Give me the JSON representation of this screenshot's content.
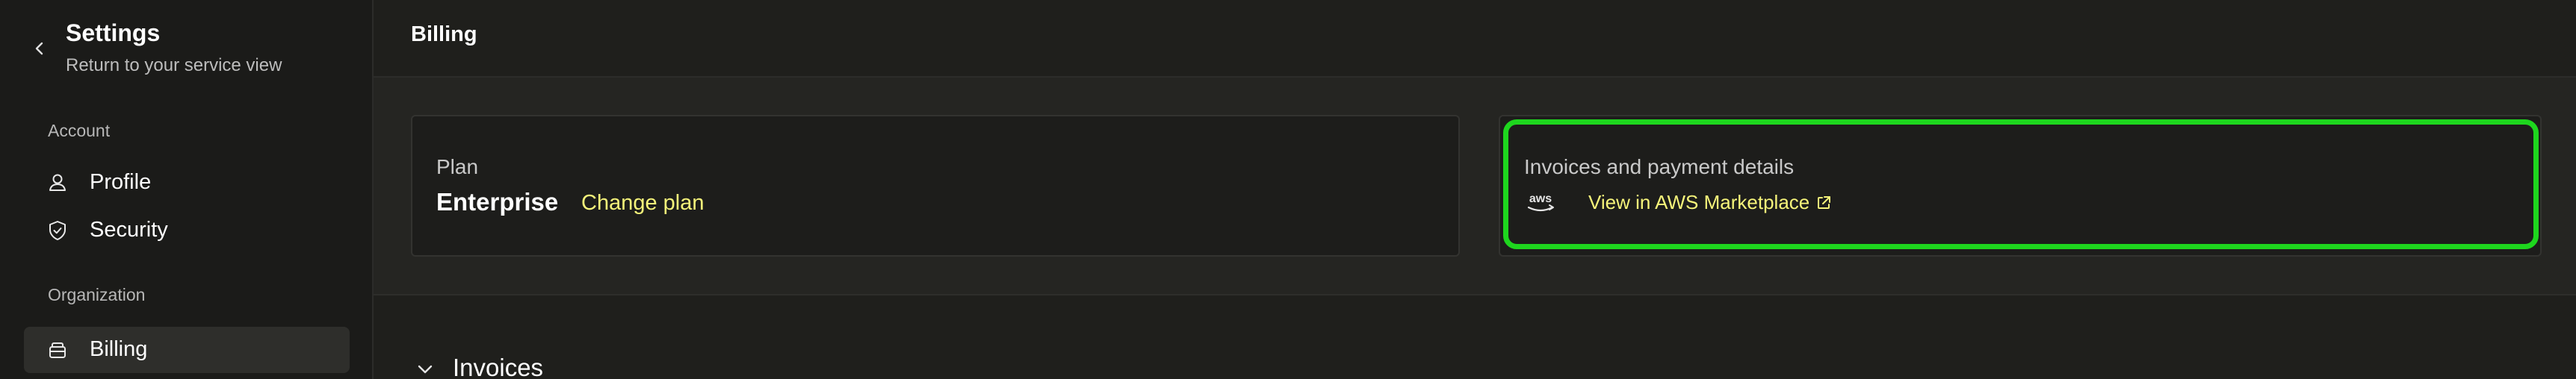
{
  "sidebar": {
    "title": "Settings",
    "subtitle": "Return to your service view",
    "sections": [
      {
        "label": "Account",
        "items": [
          {
            "label": "Profile",
            "icon": "user-icon",
            "active": false
          },
          {
            "label": "Security",
            "icon": "shield-icon",
            "active": false
          }
        ]
      },
      {
        "label": "Organization",
        "items": [
          {
            "label": "Billing",
            "icon": "wallet-icon",
            "active": true
          }
        ]
      }
    ]
  },
  "header": {
    "title": "Billing"
  },
  "plan_card": {
    "label": "Plan",
    "plan_name": "Enterprise",
    "change_plan_label": "Change plan"
  },
  "invoices_card": {
    "label": "Invoices and payment details",
    "aws_logo_text": "aws",
    "link_label": "View in AWS Marketplace",
    "link_icon": "external-link-icon"
  },
  "invoices_section": {
    "title": "Invoices",
    "expanded": true
  },
  "colors": {
    "accent_link": "#f6f47a",
    "highlight": "#1ed61e",
    "background": "#1f1f1c",
    "active_nav": "#2e2e2b"
  }
}
